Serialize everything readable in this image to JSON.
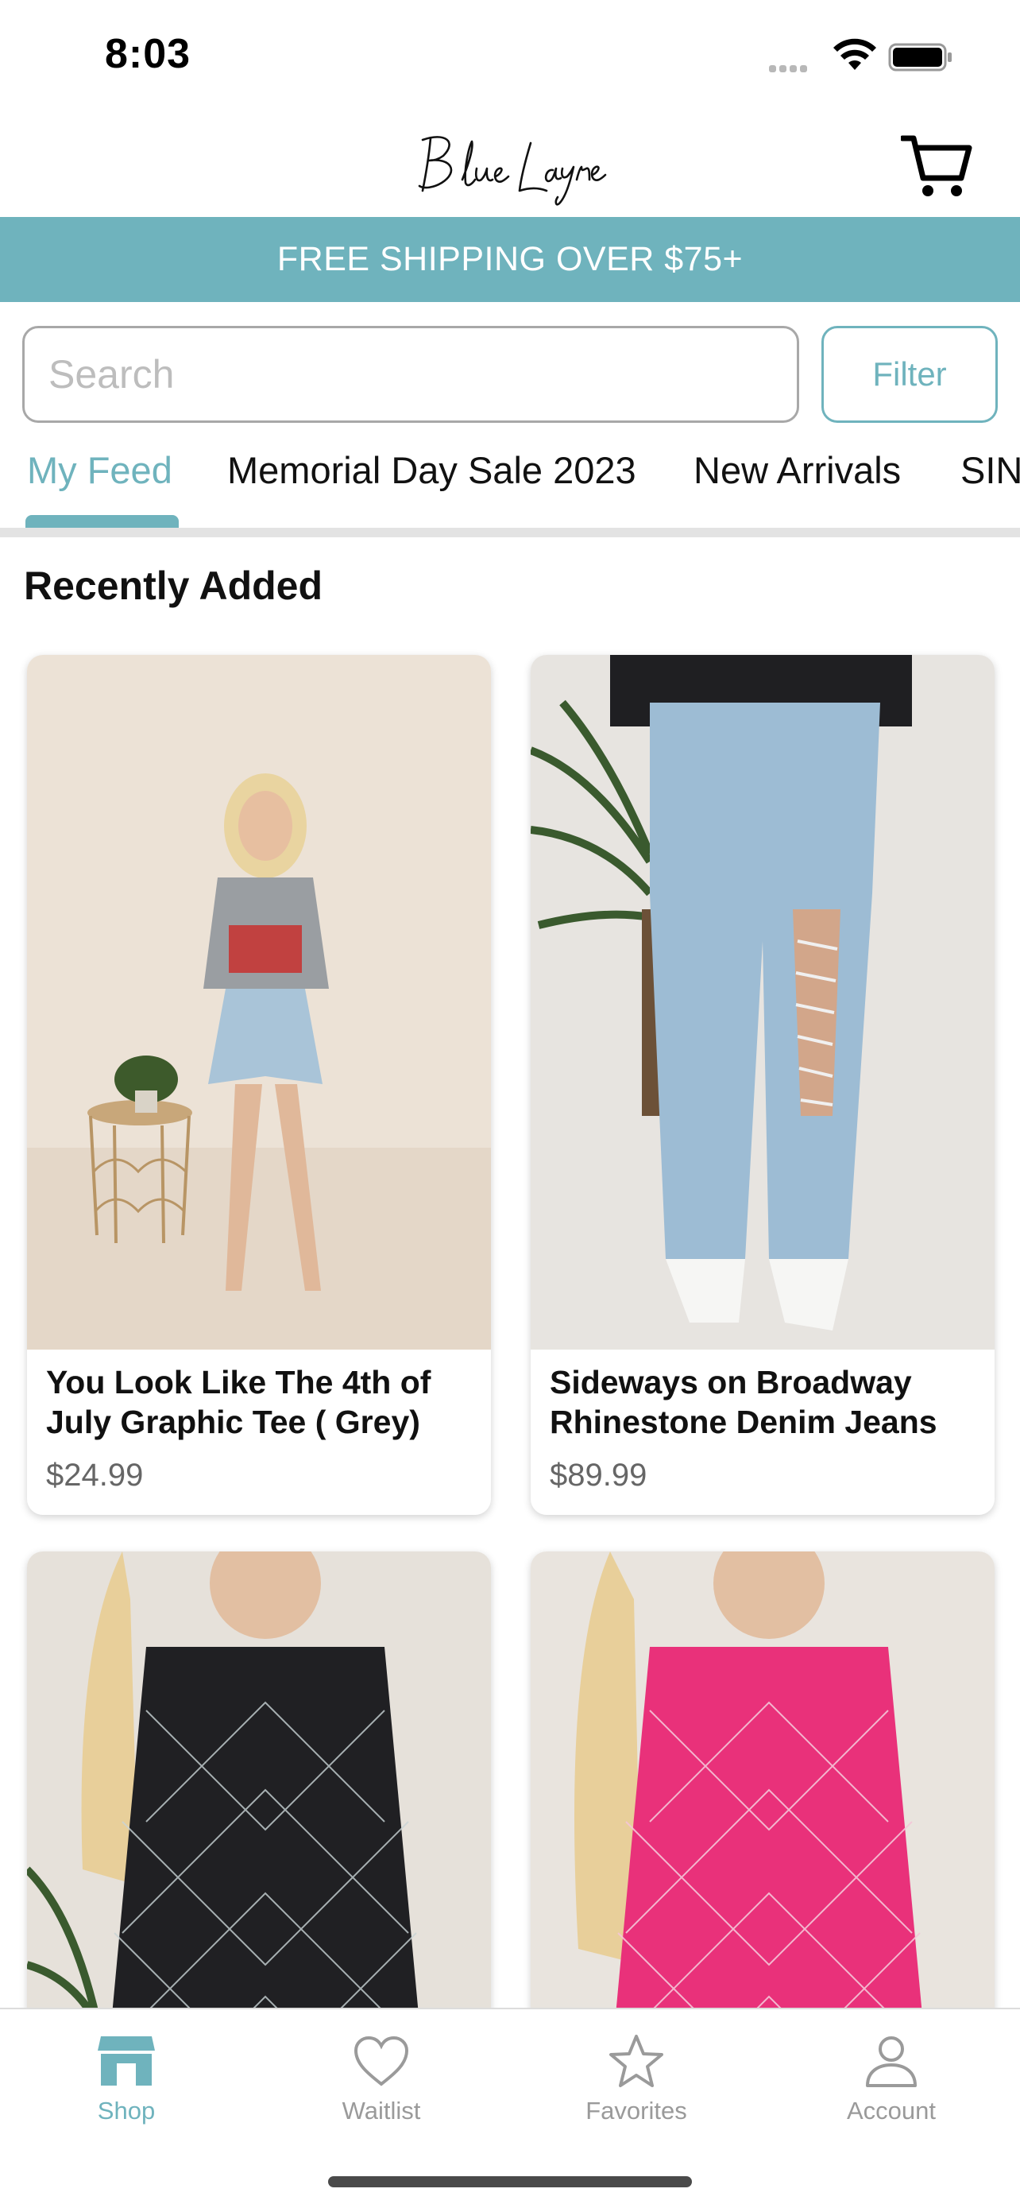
{
  "status_bar": {
    "time": "8:03"
  },
  "header": {
    "brand": "Blue Layne"
  },
  "promo": {
    "text": "FREE SHIPPING OVER $75+"
  },
  "search": {
    "placeholder": "Search",
    "value": ""
  },
  "filter": {
    "label": "Filter"
  },
  "tabs": [
    {
      "label": "My Feed",
      "active": true
    },
    {
      "label": "Memorial Day Sale 2023",
      "active": false
    },
    {
      "label": "New Arrivals",
      "active": false
    },
    {
      "label": "SIN",
      "active": false
    }
  ],
  "section": {
    "title": "Recently Added"
  },
  "products": [
    {
      "name": "You Look Like The 4th of July Graphic Tee ( Grey)",
      "price": "$24.99"
    },
    {
      "name": "Sideways on Broadway Rhinestone Denim Jeans",
      "price": "$89.99"
    },
    {
      "name": "",
      "price": ""
    },
    {
      "name": "",
      "price": ""
    }
  ],
  "nav": [
    {
      "label": "Shop",
      "icon": "storefront-icon",
      "active": true
    },
    {
      "label": "Waitlist",
      "icon": "heart-icon",
      "active": false
    },
    {
      "label": "Favorites",
      "icon": "star-icon",
      "active": false
    },
    {
      "label": "Account",
      "icon": "person-icon",
      "active": false
    }
  ],
  "colors": {
    "accent": "#6fb3bd",
    "inactive": "#9a9a9a",
    "divider": "#e3e3e3"
  }
}
